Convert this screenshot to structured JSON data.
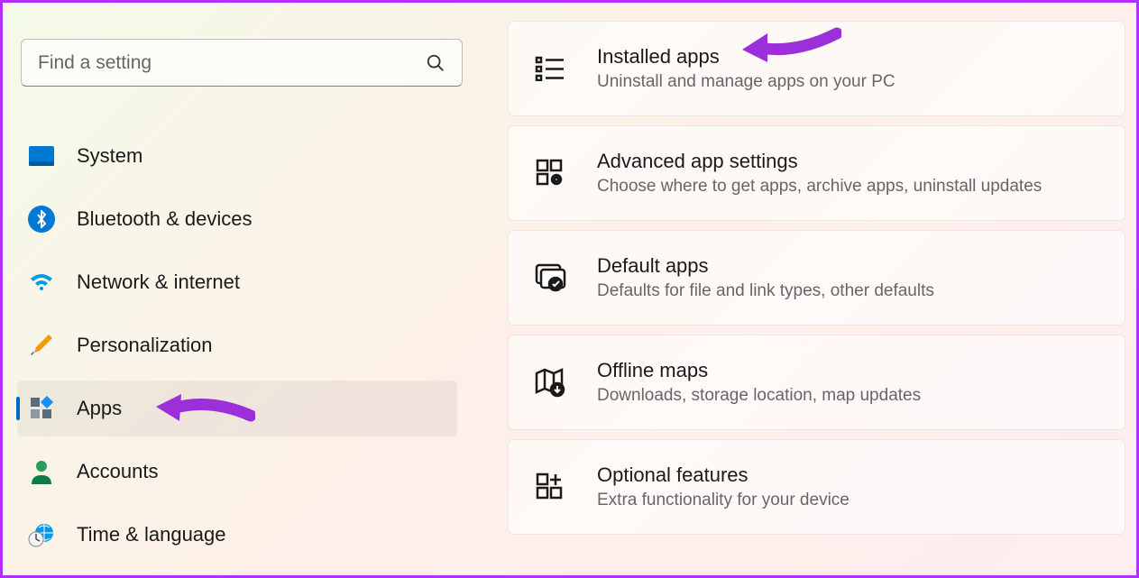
{
  "search": {
    "placeholder": "Find a setting"
  },
  "sidebar": {
    "items": [
      {
        "label": "System",
        "icon": "system"
      },
      {
        "label": "Bluetooth & devices",
        "icon": "bluetooth"
      },
      {
        "label": "Network & internet",
        "icon": "wifi"
      },
      {
        "label": "Personalization",
        "icon": "brush"
      },
      {
        "label": "Apps",
        "icon": "apps",
        "selected": true
      },
      {
        "label": "Accounts",
        "icon": "person"
      },
      {
        "label": "Time & language",
        "icon": "clock-globe"
      }
    ]
  },
  "main": {
    "cards": [
      {
        "title": "Installed apps",
        "sub": "Uninstall and manage apps on your PC",
        "icon": "list"
      },
      {
        "title": "Advanced app settings",
        "sub": "Choose where to get apps, archive apps, uninstall updates",
        "icon": "grid-gear"
      },
      {
        "title": "Default apps",
        "sub": "Defaults for file and link types, other defaults",
        "icon": "default-apps"
      },
      {
        "title": "Offline maps",
        "sub": "Downloads, storage location, map updates",
        "icon": "map"
      },
      {
        "title": "Optional features",
        "sub": "Extra functionality for your device",
        "icon": "grid-plus"
      }
    ]
  }
}
